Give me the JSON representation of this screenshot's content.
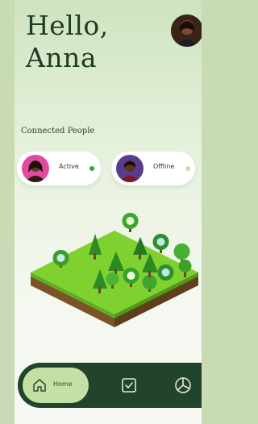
{
  "greeting": {
    "line1": "Hello,",
    "line2": "Anna"
  },
  "section": {
    "title": "Connected People"
  },
  "people": [
    {
      "status": "Active",
      "status_color": "#2ba836"
    },
    {
      "status": "Offline",
      "status_color": "#bfe3b4"
    }
  ],
  "nav": {
    "home_label": "Home"
  },
  "colors": {
    "brand_dark": "#22432c",
    "nav_active_pill": "#c5e0a4",
    "grass": "#7ecf2f",
    "soil": "#6b4a22"
  },
  "icons": {
    "home": "home-icon",
    "tasks": "checkbox-icon",
    "stats": "pie-chart-icon",
    "avatar": "user-avatar"
  }
}
